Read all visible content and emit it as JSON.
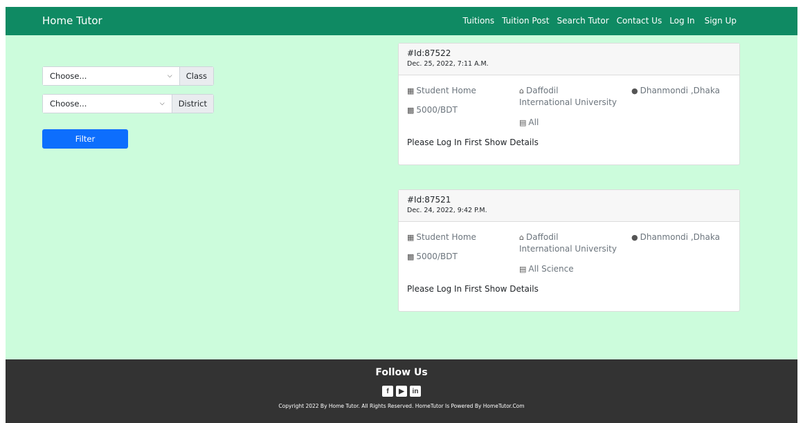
{
  "navbar": {
    "brand": "Home Tutor",
    "links": [
      "Tuitions",
      "Tuition Post",
      "Search Tutor",
      "Contact Us",
      "Log In",
      "Sign Up"
    ]
  },
  "filters": {
    "class_select": {
      "value": "Choose...",
      "label": "Class"
    },
    "district_select": {
      "value": "Choose...",
      "label": "District"
    },
    "filter_button": "Filter"
  },
  "posts": [
    {
      "id": "#Id:87522",
      "date": "Dec. 25, 2022, 7:11 A.M.",
      "medium": "Student Home",
      "salary": "5000/BDT",
      "institution_line1": "Daffodil",
      "institution_line2": "International University",
      "subject": "All",
      "location": "Dhanmondi ,Dhaka",
      "login_text": "Please Log In First Show Details"
    },
    {
      "id": "#Id:87521",
      "date": "Dec. 24, 2022, 9:42 P.M.",
      "medium": "Student Home",
      "salary": "5000/BDT",
      "institution_line1": "Daffodil",
      "institution_line2": "International University",
      "subject": "All Science",
      "location": "Dhanmondi ,Dhaka",
      "login_text": "Please Log In First Show Details"
    }
  ],
  "footer": {
    "title": "Follow Us",
    "social_icons": [
      "facebook-icon",
      "youtube-icon",
      "linkedin-icon"
    ],
    "copyright": "Copyright 2022 By Home Tutor. All Rights Reserved. HomeTutor Is Powered By HomeTutor.Com"
  },
  "colors": {
    "navbar": "#0f8a63",
    "background": "#ccfcdc",
    "button": "#0d6efd",
    "footer": "#333333"
  }
}
